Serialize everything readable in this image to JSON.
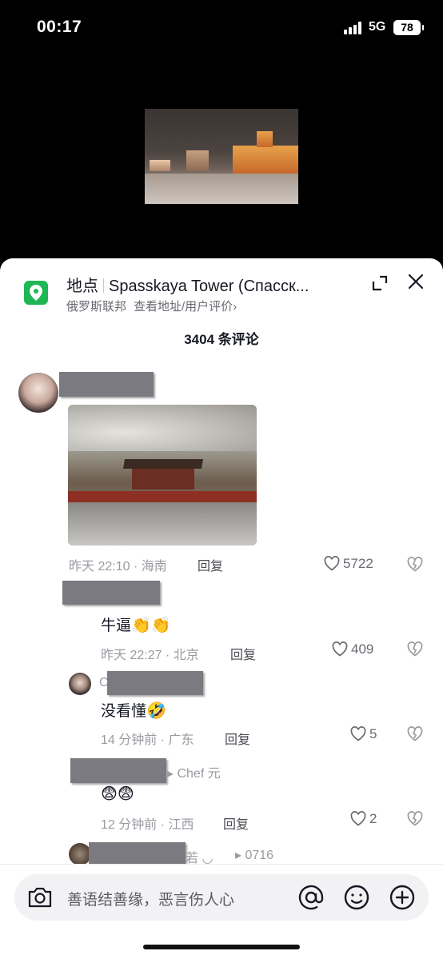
{
  "status": {
    "time": "00:17",
    "network": "5G",
    "battery": "78"
  },
  "location": {
    "label": "地点",
    "name": "Spasskaya Tower (Спасск...",
    "region": "俄罗斯联邦",
    "link": "查看地址/用户评价",
    "chevron": "›"
  },
  "comment_count": "3404 条评论",
  "comments": [
    {
      "meta": "昨天 22:10 · 海南",
      "reply": "回复",
      "likes": "5722"
    },
    {
      "text": "牛逼",
      "emojis": "👏👏",
      "meta": "昨天 22:27 · 北京",
      "reply": "回复",
      "likes": "409"
    },
    {
      "text": "没看懂",
      "emojis": "🤣",
      "meta": "14 分钟前 · 广东",
      "reply": "回复",
      "likes": "5",
      "name_prefix": "C"
    },
    {
      "ref": "▸ Chef 元",
      "emojis": "😨😨",
      "meta": "12 分钟前 · 江西",
      "reply": "回复",
      "likes": "2"
    },
    {
      "ref": "▸ 0716",
      "partial": "若 ◡"
    }
  ],
  "input": {
    "placeholder": "善语结善缘，恶言伤人心"
  },
  "icons": [
    "location-pin-icon",
    "expand-icon",
    "close-icon",
    "heart-icon",
    "broken-heart-icon",
    "camera-icon",
    "at-icon",
    "smile-icon",
    "plus-icon"
  ],
  "colors": {
    "accent_green": "#1fb655",
    "text_primary": "#161823",
    "text_secondary": "#9a9aa2"
  }
}
